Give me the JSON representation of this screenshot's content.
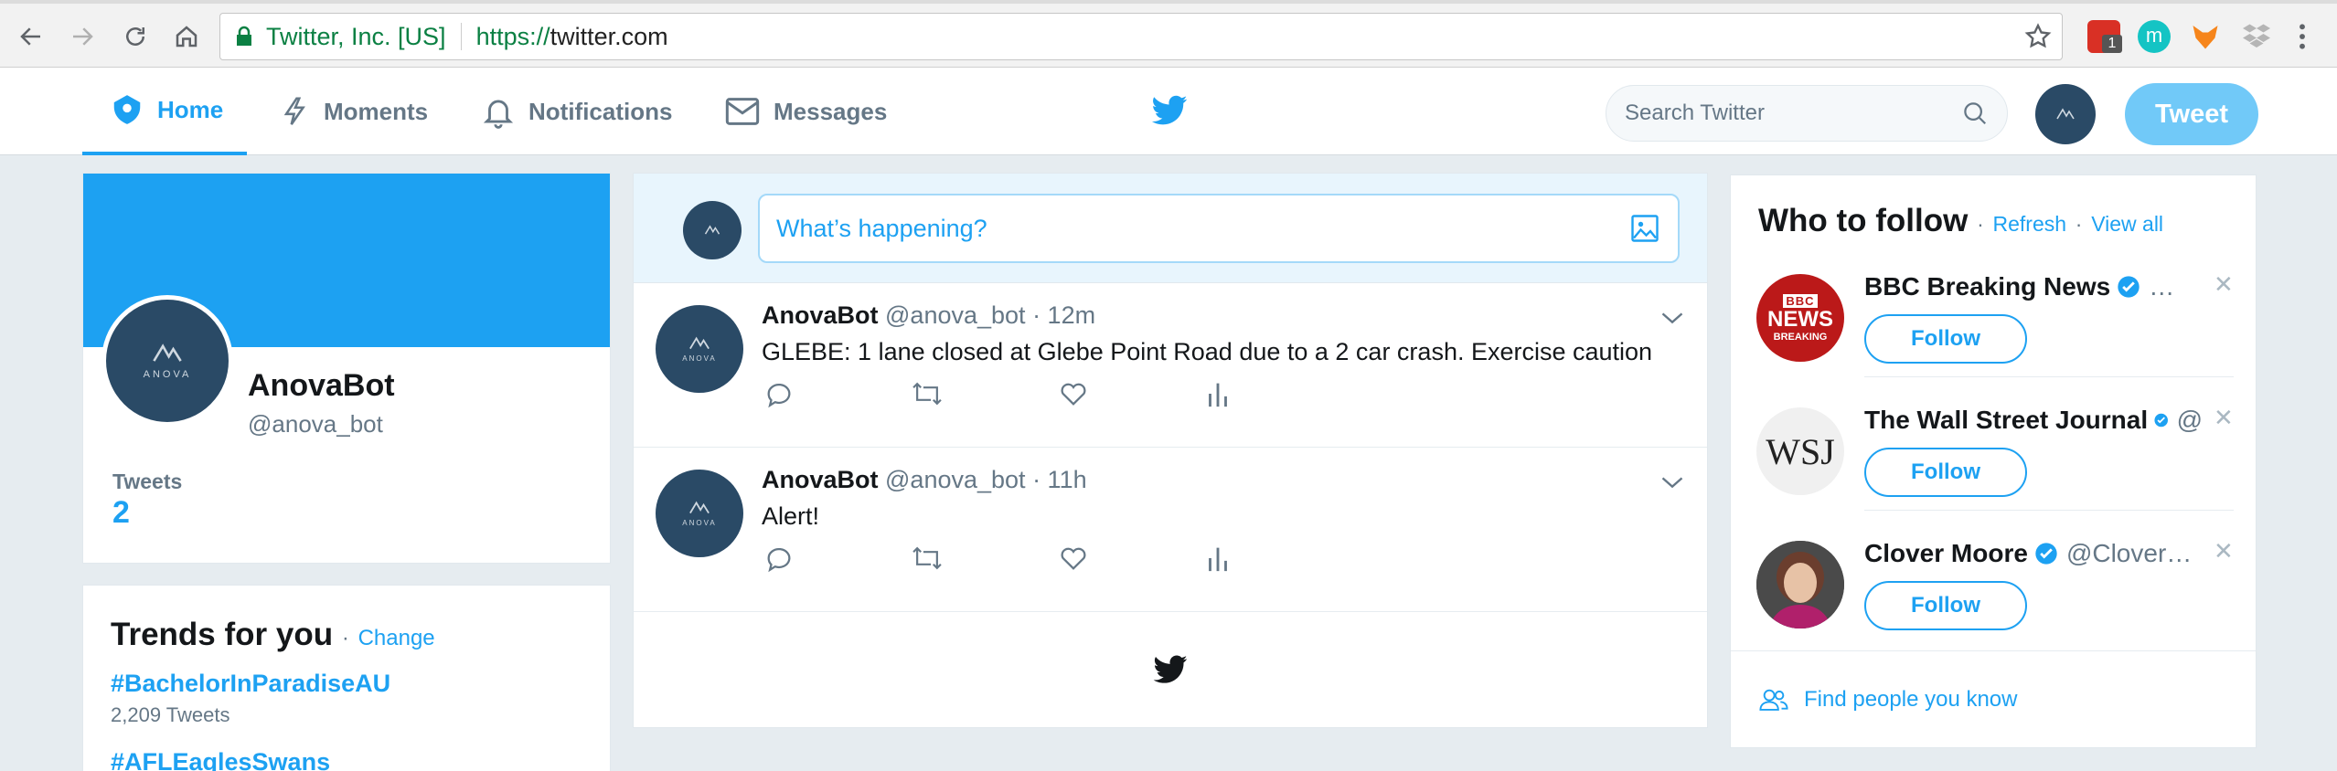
{
  "browser": {
    "secure_label": "Twitter, Inc. [US]",
    "url_scheme": "https://",
    "url_host": "twitter.com",
    "ext_badge": "1"
  },
  "header": {
    "nav": [
      {
        "label": "Home",
        "icon": "home-icon",
        "active": true
      },
      {
        "label": "Moments",
        "icon": "lightning-icon",
        "active": false
      },
      {
        "label": "Notifications",
        "icon": "bell-icon",
        "active": false
      },
      {
        "label": "Messages",
        "icon": "envelope-icon",
        "active": false
      }
    ],
    "logo": "twitter-bird-icon",
    "search_placeholder": "Search Twitter",
    "tweet_button": "Tweet"
  },
  "profile": {
    "name": "AnovaBot",
    "handle": "@anova_bot",
    "avatar_text": "ANOVA",
    "stat_label": "Tweets",
    "stat_value": "2"
  },
  "trends": {
    "title": "Trends for you",
    "change_label": "Change",
    "items": [
      {
        "tag": "#BachelorInParadiseAU",
        "count": "2,209 Tweets"
      },
      {
        "tag": "#AFLEaglesSwans",
        "count": ""
      }
    ]
  },
  "compose": {
    "placeholder": "What’s happening?"
  },
  "tweets": [
    {
      "name": "AnovaBot",
      "handle": "@anova_bot",
      "time": "· 12m",
      "text": "GLEBE: 1 lane closed at Glebe Point Road due to a 2 car crash. Exercise caution"
    },
    {
      "name": "AnovaBot",
      "handle": "@anova_bot",
      "time": "· 11h",
      "text": "Alert!"
    }
  ],
  "who_to_follow": {
    "title": "Who to follow",
    "refresh": "Refresh",
    "view_all": "View all",
    "items": [
      {
        "name": "BBC Breaking News",
        "handle": "…",
        "follow": "Follow",
        "avatar_lines": [
          "BBC",
          "NEWS",
          "BREAKING"
        ]
      },
      {
        "name": "The Wall Street Journal",
        "handle": "@",
        "follow": "Follow",
        "avatar_text": "WSJ"
      },
      {
        "name": "Clover Moore",
        "handle": "@Clover…",
        "follow": "Follow"
      }
    ],
    "find_people": "Find people you know"
  },
  "colors": {
    "twitter_blue": "#1da1f2",
    "tweet_button_bg": "#71c9f8",
    "page_bg": "#e6ecf0",
    "avatar_bg": "#2a4a66",
    "bbc_red": "#bb1919"
  }
}
